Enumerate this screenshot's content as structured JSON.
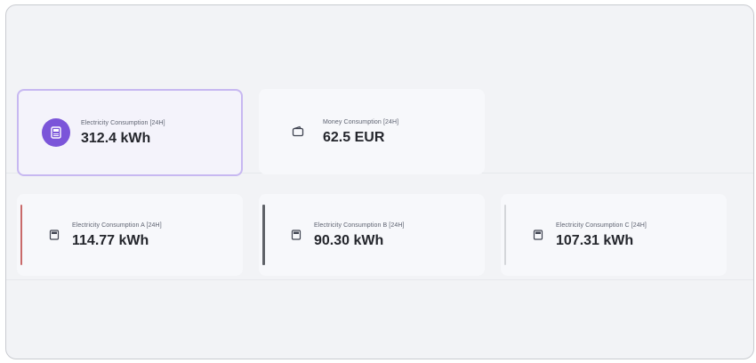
{
  "cards": {
    "total": {
      "label": "Electricity Consumption [24H]",
      "value": "312.4 kWh",
      "icon": "meter-icon",
      "accent": "#7b55d9"
    },
    "money": {
      "label": "Money Consumption [24H]",
      "value": "62.5 EUR",
      "icon": "wallet-icon"
    },
    "phase_a": {
      "label": "Electricity Consumption A [24H]",
      "value": "114.77 kWh",
      "icon": "meter-icon",
      "accent": "#c96a6a"
    },
    "phase_b": {
      "label": "Electricity Consumption B [24H]",
      "value": "90.30 kWh",
      "icon": "meter-icon",
      "accent": "#5f6268"
    },
    "phase_c": {
      "label": "Electricity Consumption C [24H]",
      "value": "107.31 kWh",
      "icon": "meter-icon",
      "accent": "#d4d6da"
    }
  }
}
